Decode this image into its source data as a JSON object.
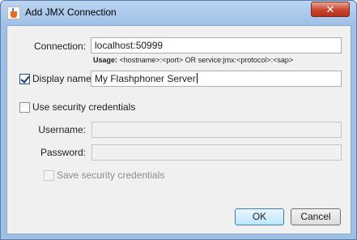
{
  "window": {
    "title": "Add JMX Connection",
    "close_glyph": "✕",
    "app_icon": "java-coffee-cup-icon"
  },
  "connection": {
    "label": "Connection:",
    "value": "localhost:50999",
    "usage_bold": "Usage:",
    "usage_text": "<hostname>:<port> OR service:jmx:<protocol>:<sap>"
  },
  "display_name": {
    "label": "Display name:",
    "checked": true,
    "value": "My Flashphoner Server"
  },
  "security": {
    "label": "Use security credentials",
    "checked": false,
    "username_label": "Username:",
    "username_value": "",
    "password_label": "Password:",
    "password_value": "",
    "save_label": "Save security credentials",
    "save_checked": false,
    "save_enabled": false
  },
  "buttons": {
    "ok": "OK",
    "cancel": "Cancel"
  },
  "colors": {
    "title_bar": "#9fc0e6",
    "close_button": "#c7452d",
    "client_bg": "#f0f0f0"
  }
}
